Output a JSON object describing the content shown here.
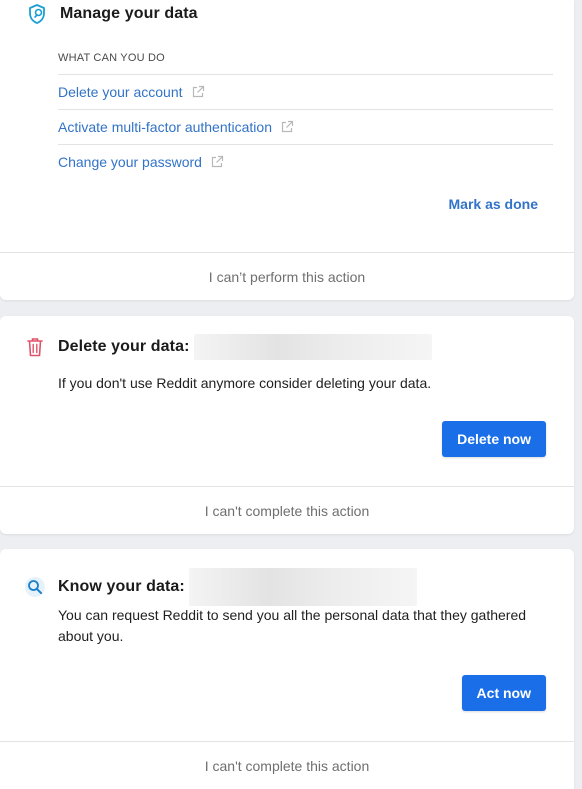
{
  "manage_card": {
    "title": "Manage your data",
    "icon": "shield-icon",
    "section_label": "WHAT CAN YOU DO",
    "actions": [
      {
        "label": "Delete your account",
        "icon": "external-link-icon"
      },
      {
        "label": "Activate multi-factor authentication",
        "icon": "external-link-icon"
      },
      {
        "label": "Change your password",
        "icon": "external-link-icon"
      }
    ],
    "mark_done_label": "Mark as done",
    "footer_label": "I can’t perform this action"
  },
  "delete_card": {
    "title": "Delete your data:",
    "icon": "trash-icon",
    "description": "If you don't use Reddit anymore consider deleting your data.",
    "button_label": "Delete now",
    "footer_label": "I can't complete this action"
  },
  "know_card": {
    "title": "Know your data:",
    "icon": "search-icon",
    "description_line1": "You can request Reddit to send you all the personal data that they gathered",
    "description_line2": "about you.",
    "button_label": "Act now",
    "footer_label": "I can't complete this action"
  },
  "colors": {
    "link": "#3273c8",
    "primary_button": "#1a6fe8",
    "shield_icon": "#1a9fd4",
    "trash_icon": "#e0526a",
    "search_icon": "#1a7ec8"
  }
}
